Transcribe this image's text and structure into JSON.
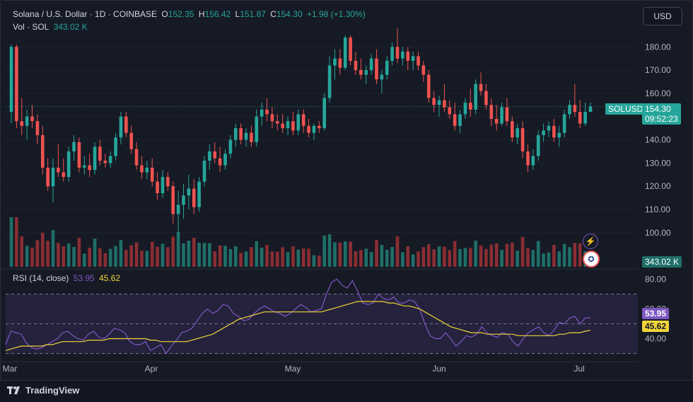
{
  "header": {
    "symbol_title": "Solana / U.S. Dollar · 1D · COINBASE",
    "o_label": "O",
    "o_value": "152.35",
    "h_label": "H",
    "h_value": "156.42",
    "l_label": "L",
    "l_value": "151.87",
    "c_label": "C",
    "c_value": "154.30",
    "change": "+1.98 (+1.30%)",
    "vol_label": "Vol · SOL",
    "vol_value": "343.02 K"
  },
  "currency_button": "USD",
  "price_tag": {
    "symbol": "SOLUSD",
    "price": "154.30",
    "countdown": "09:52:23"
  },
  "volume_tag": "343.02 K",
  "rsi": {
    "label": "RSI (14, close)",
    "value": "53.95",
    "ma_value": "45.62",
    "ticks": [
      "80.00",
      "60.00",
      "40.00"
    ]
  },
  "footer": {
    "brand": "TradingView"
  },
  "colors": {
    "up": "#26a69a",
    "down": "#ef5350",
    "vol_up": "#1f6f68",
    "vol_down": "#8a2e33",
    "rsi_line": "#7e57c2",
    "rsi_ma": "#f0d43a",
    "rsi_band": "#2b2546",
    "background": "#161a25"
  },
  "chart_data": {
    "type": "candlestick",
    "title": "Solana / U.S. Dollar · 1D · COINBASE",
    "price_axis": {
      "ticks": [
        100,
        110,
        120,
        130,
        140,
        150,
        160,
        170,
        180
      ],
      "range": [
        85,
        188
      ]
    },
    "x_axis": {
      "tick_labels": [
        "Mar",
        "Apr",
        "May",
        "Jun",
        "Jul"
      ]
    },
    "current_price_line": 154.3,
    "candles": [
      {
        "o": 152,
        "h": 181,
        "l": 147,
        "c": 180
      },
      {
        "o": 180,
        "h": 181,
        "l": 145,
        "c": 148
      },
      {
        "o": 148,
        "h": 158,
        "l": 142,
        "c": 146
      },
      {
        "o": 146,
        "h": 153,
        "l": 140,
        "c": 150
      },
      {
        "o": 150,
        "h": 155,
        "l": 145,
        "c": 148
      },
      {
        "o": 148,
        "h": 151,
        "l": 138,
        "c": 142
      },
      {
        "o": 142,
        "h": 146,
        "l": 125,
        "c": 128
      },
      {
        "o": 128,
        "h": 132,
        "l": 118,
        "c": 120
      },
      {
        "o": 120,
        "h": 132,
        "l": 113,
        "c": 128
      },
      {
        "o": 128,
        "h": 138,
        "l": 124,
        "c": 126
      },
      {
        "o": 126,
        "h": 132,
        "l": 122,
        "c": 124
      },
      {
        "o": 124,
        "h": 137,
        "l": 122,
        "c": 135
      },
      {
        "o": 135,
        "h": 142,
        "l": 131,
        "c": 139
      },
      {
        "o": 139,
        "h": 141,
        "l": 126,
        "c": 128
      },
      {
        "o": 128,
        "h": 133,
        "l": 125,
        "c": 129
      },
      {
        "o": 129,
        "h": 134,
        "l": 124,
        "c": 127
      },
      {
        "o": 127,
        "h": 139,
        "l": 125,
        "c": 137
      },
      {
        "o": 137,
        "h": 140,
        "l": 129,
        "c": 131
      },
      {
        "o": 131,
        "h": 134,
        "l": 128,
        "c": 130
      },
      {
        "o": 130,
        "h": 135,
        "l": 128,
        "c": 133
      },
      {
        "o": 133,
        "h": 143,
        "l": 131,
        "c": 141
      },
      {
        "o": 141,
        "h": 152,
        "l": 138,
        "c": 150
      },
      {
        "o": 150,
        "h": 152,
        "l": 141,
        "c": 143
      },
      {
        "o": 143,
        "h": 146,
        "l": 134,
        "c": 136
      },
      {
        "o": 136,
        "h": 139,
        "l": 127,
        "c": 129
      },
      {
        "o": 129,
        "h": 133,
        "l": 123,
        "c": 126
      },
      {
        "o": 126,
        "h": 131,
        "l": 123,
        "c": 128
      },
      {
        "o": 128,
        "h": 132,
        "l": 120,
        "c": 122
      },
      {
        "o": 122,
        "h": 126,
        "l": 114,
        "c": 117
      },
      {
        "o": 117,
        "h": 127,
        "l": 115,
        "c": 124
      },
      {
        "o": 124,
        "h": 126,
        "l": 118,
        "c": 120
      },
      {
        "o": 120,
        "h": 122,
        "l": 104,
        "c": 108
      },
      {
        "o": 108,
        "h": 118,
        "l": 99,
        "c": 112
      },
      {
        "o": 112,
        "h": 121,
        "l": 106,
        "c": 116
      },
      {
        "o": 116,
        "h": 125,
        "l": 110,
        "c": 119
      },
      {
        "o": 119,
        "h": 123,
        "l": 108,
        "c": 111
      },
      {
        "o": 111,
        "h": 124,
        "l": 109,
        "c": 122
      },
      {
        "o": 122,
        "h": 133,
        "l": 120,
        "c": 131
      },
      {
        "o": 131,
        "h": 138,
        "l": 127,
        "c": 135
      },
      {
        "o": 135,
        "h": 139,
        "l": 130,
        "c": 132
      },
      {
        "o": 132,
        "h": 137,
        "l": 126,
        "c": 129
      },
      {
        "o": 129,
        "h": 136,
        "l": 127,
        "c": 134
      },
      {
        "o": 134,
        "h": 142,
        "l": 132,
        "c": 140
      },
      {
        "o": 140,
        "h": 147,
        "l": 137,
        "c": 145
      },
      {
        "o": 145,
        "h": 147,
        "l": 138,
        "c": 140
      },
      {
        "o": 140,
        "h": 145,
        "l": 137,
        "c": 143
      },
      {
        "o": 143,
        "h": 146,
        "l": 137,
        "c": 139
      },
      {
        "o": 139,
        "h": 153,
        "l": 137,
        "c": 150
      },
      {
        "o": 150,
        "h": 156,
        "l": 146,
        "c": 153
      },
      {
        "o": 153,
        "h": 158,
        "l": 148,
        "c": 151
      },
      {
        "o": 151,
        "h": 154,
        "l": 145,
        "c": 148
      },
      {
        "o": 148,
        "h": 151,
        "l": 144,
        "c": 147
      },
      {
        "o": 147,
        "h": 151,
        "l": 143,
        "c": 145
      },
      {
        "o": 145,
        "h": 150,
        "l": 142,
        "c": 148
      },
      {
        "o": 148,
        "h": 152,
        "l": 142,
        "c": 144
      },
      {
        "o": 144,
        "h": 153,
        "l": 142,
        "c": 151
      },
      {
        "o": 151,
        "h": 153,
        "l": 143,
        "c": 146
      },
      {
        "o": 146,
        "h": 149,
        "l": 141,
        "c": 143
      },
      {
        "o": 143,
        "h": 147,
        "l": 140,
        "c": 146
      },
      {
        "o": 146,
        "h": 148,
        "l": 143,
        "c": 145
      },
      {
        "o": 145,
        "h": 160,
        "l": 144,
        "c": 158
      },
      {
        "o": 158,
        "h": 176,
        "l": 156,
        "c": 172
      },
      {
        "o": 172,
        "h": 179,
        "l": 166,
        "c": 175
      },
      {
        "o": 175,
        "h": 179,
        "l": 168,
        "c": 171
      },
      {
        "o": 171,
        "h": 185,
        "l": 170,
        "c": 184
      },
      {
        "o": 184,
        "h": 185,
        "l": 172,
        "c": 174
      },
      {
        "o": 174,
        "h": 178,
        "l": 168,
        "c": 170
      },
      {
        "o": 170,
        "h": 175,
        "l": 166,
        "c": 168
      },
      {
        "o": 168,
        "h": 172,
        "l": 164,
        "c": 170
      },
      {
        "o": 170,
        "h": 177,
        "l": 168,
        "c": 175
      },
      {
        "o": 175,
        "h": 179,
        "l": 164,
        "c": 166
      },
      {
        "o": 166,
        "h": 170,
        "l": 160,
        "c": 168
      },
      {
        "o": 168,
        "h": 176,
        "l": 166,
        "c": 174
      },
      {
        "o": 174,
        "h": 182,
        "l": 172,
        "c": 180
      },
      {
        "o": 180,
        "h": 188,
        "l": 173,
        "c": 175
      },
      {
        "o": 175,
        "h": 180,
        "l": 172,
        "c": 178
      },
      {
        "o": 178,
        "h": 180,
        "l": 170,
        "c": 174
      },
      {
        "o": 174,
        "h": 178,
        "l": 170,
        "c": 176
      },
      {
        "o": 176,
        "h": 178,
        "l": 170,
        "c": 172
      },
      {
        "o": 172,
        "h": 174,
        "l": 165,
        "c": 168
      },
      {
        "o": 168,
        "h": 170,
        "l": 156,
        "c": 158
      },
      {
        "o": 158,
        "h": 161,
        "l": 152,
        "c": 155
      },
      {
        "o": 155,
        "h": 159,
        "l": 150,
        "c": 157
      },
      {
        "o": 157,
        "h": 164,
        "l": 152,
        "c": 154
      },
      {
        "o": 154,
        "h": 157,
        "l": 149,
        "c": 151
      },
      {
        "o": 151,
        "h": 156,
        "l": 144,
        "c": 146
      },
      {
        "o": 146,
        "h": 153,
        "l": 143,
        "c": 151
      },
      {
        "o": 151,
        "h": 158,
        "l": 149,
        "c": 156
      },
      {
        "o": 156,
        "h": 162,
        "l": 150,
        "c": 153
      },
      {
        "o": 153,
        "h": 166,
        "l": 151,
        "c": 164
      },
      {
        "o": 164,
        "h": 169,
        "l": 159,
        "c": 161
      },
      {
        "o": 161,
        "h": 164,
        "l": 153,
        "c": 155
      },
      {
        "o": 155,
        "h": 158,
        "l": 146,
        "c": 149
      },
      {
        "o": 149,
        "h": 155,
        "l": 144,
        "c": 147
      },
      {
        "o": 147,
        "h": 156,
        "l": 146,
        "c": 154
      },
      {
        "o": 154,
        "h": 158,
        "l": 146,
        "c": 148
      },
      {
        "o": 148,
        "h": 150,
        "l": 139,
        "c": 141
      },
      {
        "o": 141,
        "h": 147,
        "l": 138,
        "c": 145
      },
      {
        "o": 145,
        "h": 148,
        "l": 132,
        "c": 135
      },
      {
        "o": 135,
        "h": 138,
        "l": 126,
        "c": 129
      },
      {
        "o": 129,
        "h": 136,
        "l": 127,
        "c": 133
      },
      {
        "o": 133,
        "h": 144,
        "l": 131,
        "c": 142
      },
      {
        "o": 142,
        "h": 147,
        "l": 139,
        "c": 144
      },
      {
        "o": 144,
        "h": 148,
        "l": 141,
        "c": 146
      },
      {
        "o": 146,
        "h": 149,
        "l": 139,
        "c": 141
      },
      {
        "o": 141,
        "h": 146,
        "l": 137,
        "c": 143
      },
      {
        "o": 143,
        "h": 153,
        "l": 141,
        "c": 151
      },
      {
        "o": 151,
        "h": 157,
        "l": 149,
        "c": 155
      },
      {
        "o": 155,
        "h": 164,
        "l": 150,
        "c": 152
      },
      {
        "o": 152,
        "h": 157,
        "l": 145,
        "c": 147
      },
      {
        "o": 147,
        "h": 156,
        "l": 146,
        "c": 152
      },
      {
        "o": 152,
        "h": 156,
        "l": 152,
        "c": 154.3
      }
    ],
    "volume_note": "volume bars in thousands (no axis printed)",
    "rsi_series": [
      36,
      45,
      44,
      43,
      37,
      34,
      33,
      34,
      36,
      38,
      40,
      44,
      45,
      42,
      40,
      39,
      43,
      45,
      41,
      40,
      43,
      47,
      46,
      44,
      38,
      36,
      36,
      38,
      32,
      34,
      36,
      30,
      35,
      39,
      44,
      45,
      47,
      52,
      57,
      60,
      57,
      59,
      63,
      62,
      57,
      55,
      52,
      53,
      57,
      60,
      62,
      60,
      58,
      57,
      55,
      57,
      60,
      63,
      61,
      58,
      59,
      60,
      70,
      78,
      80,
      76,
      74,
      79,
      72,
      64,
      63,
      64,
      70,
      67,
      66,
      68,
      64,
      64,
      66,
      65,
      60,
      50,
      42,
      40,
      40,
      44,
      40,
      35,
      38,
      42,
      41,
      43,
      48,
      44,
      42,
      41,
      44,
      43,
      38,
      35,
      40,
      44,
      46,
      48,
      44,
      42,
      46,
      51,
      50,
      54,
      55,
      50,
      54,
      53.95
    ],
    "rsi_ma_series": [
      32,
      33,
      34,
      35,
      35,
      35,
      35,
      35,
      36,
      36,
      37,
      38,
      38,
      38,
      38,
      38,
      39,
      39,
      39,
      39,
      40,
      40,
      40,
      40,
      40,
      40,
      40,
      40,
      39,
      39,
      38,
      38,
      38,
      38,
      38,
      38,
      39,
      40,
      41,
      42,
      43,
      45,
      47,
      49,
      51,
      53,
      54,
      55,
      56,
      57,
      58,
      58,
      58,
      58,
      58,
      58,
      58,
      58,
      58,
      58,
      58,
      58,
      59,
      60,
      61,
      62,
      63,
      64,
      65,
      65,
      65,
      65,
      65,
      65,
      64,
      64,
      63,
      62,
      62,
      61,
      60,
      58,
      56,
      54,
      52,
      50,
      48,
      47,
      46,
      45,
      44,
      44,
      44,
      43,
      43,
      43,
      43,
      43,
      43,
      42,
      42,
      42,
      42,
      42,
      42,
      42,
      42,
      43,
      43,
      44,
      44,
      44,
      45,
      45.62
    ],
    "rsi_axis": {
      "ticks": [
        80,
        60,
        40
      ],
      "range": [
        25,
        85
      ]
    },
    "rsi_bands": [
      70,
      50,
      30
    ]
  }
}
